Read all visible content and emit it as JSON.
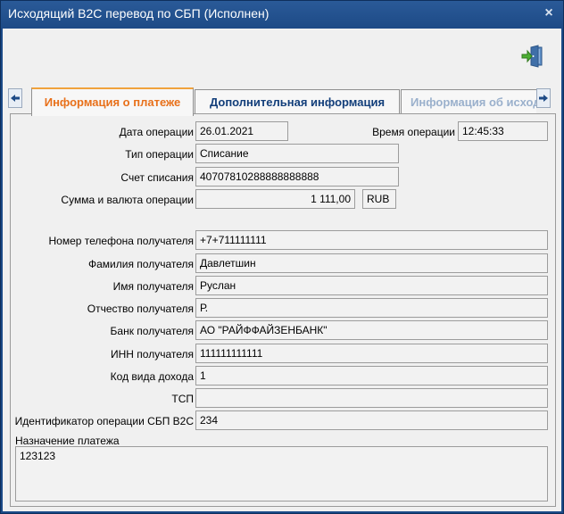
{
  "window": {
    "title": "Исходящий B2C перевод по СБП (Исполнен)",
    "close_glyph": "×"
  },
  "toolbar": {
    "exit_icon": "exit-door-icon"
  },
  "tabs": [
    {
      "label": "Информация о платеже",
      "active": true
    },
    {
      "label": "Дополнительная информация",
      "active": false
    },
    {
      "label": "Информация об исходящем переводе",
      "active": false
    }
  ],
  "fields": {
    "op_date_label": "Дата операции",
    "op_date_value": "26.01.2021",
    "op_time_label": "Время операции",
    "op_time_value": "12:45:33",
    "op_type_label": "Тип операции",
    "op_type_value": "Списание",
    "account_label": "Счет списания",
    "account_value": "40707810288888888888",
    "amount_label": "Сумма и валюта операции",
    "amount_value": "1 111,00",
    "currency_value": "RUB",
    "phone_label": "Номер телефона получателя",
    "phone_value": "+7+711111111",
    "last_name_label": "Фамилия получателя",
    "last_name_value": "Давлетшин",
    "first_name_label": "Имя получателя",
    "first_name_value": "Руслан",
    "middle_name_label": "Отчество получателя",
    "middle_name_value": "Р.",
    "bank_label": "Банк получателя",
    "bank_value": "АО \"РАЙФФАЙЗЕНБАНК\"",
    "inn_label": "ИНН получателя",
    "inn_value": "111111111111",
    "income_code_label": "Код вида дохода",
    "income_code_value": "1",
    "tsp_label": "ТСП",
    "tsp_value": "",
    "sbp_id_label": "Идентификатор операции СБП B2C",
    "sbp_id_value": "234",
    "purpose_label": "Назначение платежа",
    "purpose_value": "123123"
  }
}
